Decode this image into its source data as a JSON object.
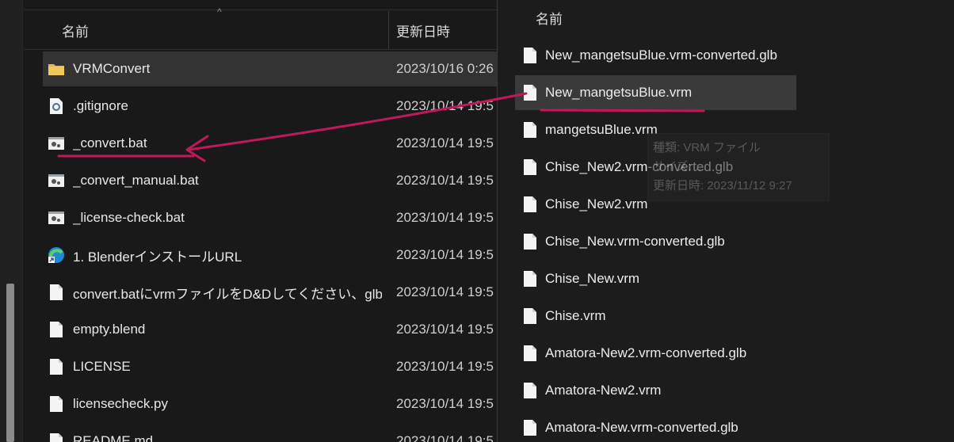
{
  "left": {
    "header_name": "名前",
    "header_date": "更新日時",
    "rows": [
      {
        "label": "VRMConvert",
        "date": "2023/10/16 0:26",
        "icon": "folder-icon"
      },
      {
        "label": ".gitignore",
        "date": "2023/10/14 19:5",
        "icon": "settings-file-icon"
      },
      {
        "label": "_convert.bat",
        "date": "2023/10/14 19:5",
        "icon": "batch-file-icon"
      },
      {
        "label": "_convert_manual.bat",
        "date": "2023/10/14 19:5",
        "icon": "batch-file-icon"
      },
      {
        "label": "_license-check.bat",
        "date": "2023/10/14 19:5",
        "icon": "batch-file-icon"
      },
      {
        "label": "1. BlenderインストールURL",
        "date": "2023/10/14 19:5",
        "icon": "edge-shortcut-icon"
      },
      {
        "label": "convert.batにvrmファイルをD&Dしてください、glbファ...",
        "date": "2023/10/14 19:5",
        "icon": "file-icon"
      },
      {
        "label": "empty.blend",
        "date": "2023/10/14 19:5",
        "icon": "file-icon"
      },
      {
        "label": "LICENSE",
        "date": "2023/10/14 19:5",
        "icon": "file-icon"
      },
      {
        "label": "licensecheck.py",
        "date": "2023/10/14 19:5",
        "icon": "file-icon"
      },
      {
        "label": "README.md",
        "date": "2023/10/14 19:5",
        "icon": "file-icon"
      }
    ]
  },
  "right": {
    "header_name": "名前",
    "rows": [
      {
        "label": "New_mangetsuBlue.vrm-converted.glb"
      },
      {
        "label": "New_mangetsuBlue.vrm"
      },
      {
        "label": "mangetsuBlue.vrm"
      },
      {
        "label": "Chise_New2.vrm-converted.glb"
      },
      {
        "label": "Chise_New2.vrm"
      },
      {
        "label": "Chise_New.vrm-converted.glb"
      },
      {
        "label": "Chise_New.vrm"
      },
      {
        "label": "Chise.vrm"
      },
      {
        "label": "Amatora-New2.vrm-converted.glb"
      },
      {
        "label": "Amatora-New2.vrm"
      },
      {
        "label": "Amatora-New.vrm-converted.glb"
      }
    ]
  },
  "tooltip": {
    "type": "種類: VRM ファイル",
    "size": "サイズ: ...",
    "date": "更新日時: 2023/11/12 9:27"
  },
  "colors": {
    "annotation": "#c2185b",
    "folder": "#e8b64a",
    "selection": "#333333"
  }
}
